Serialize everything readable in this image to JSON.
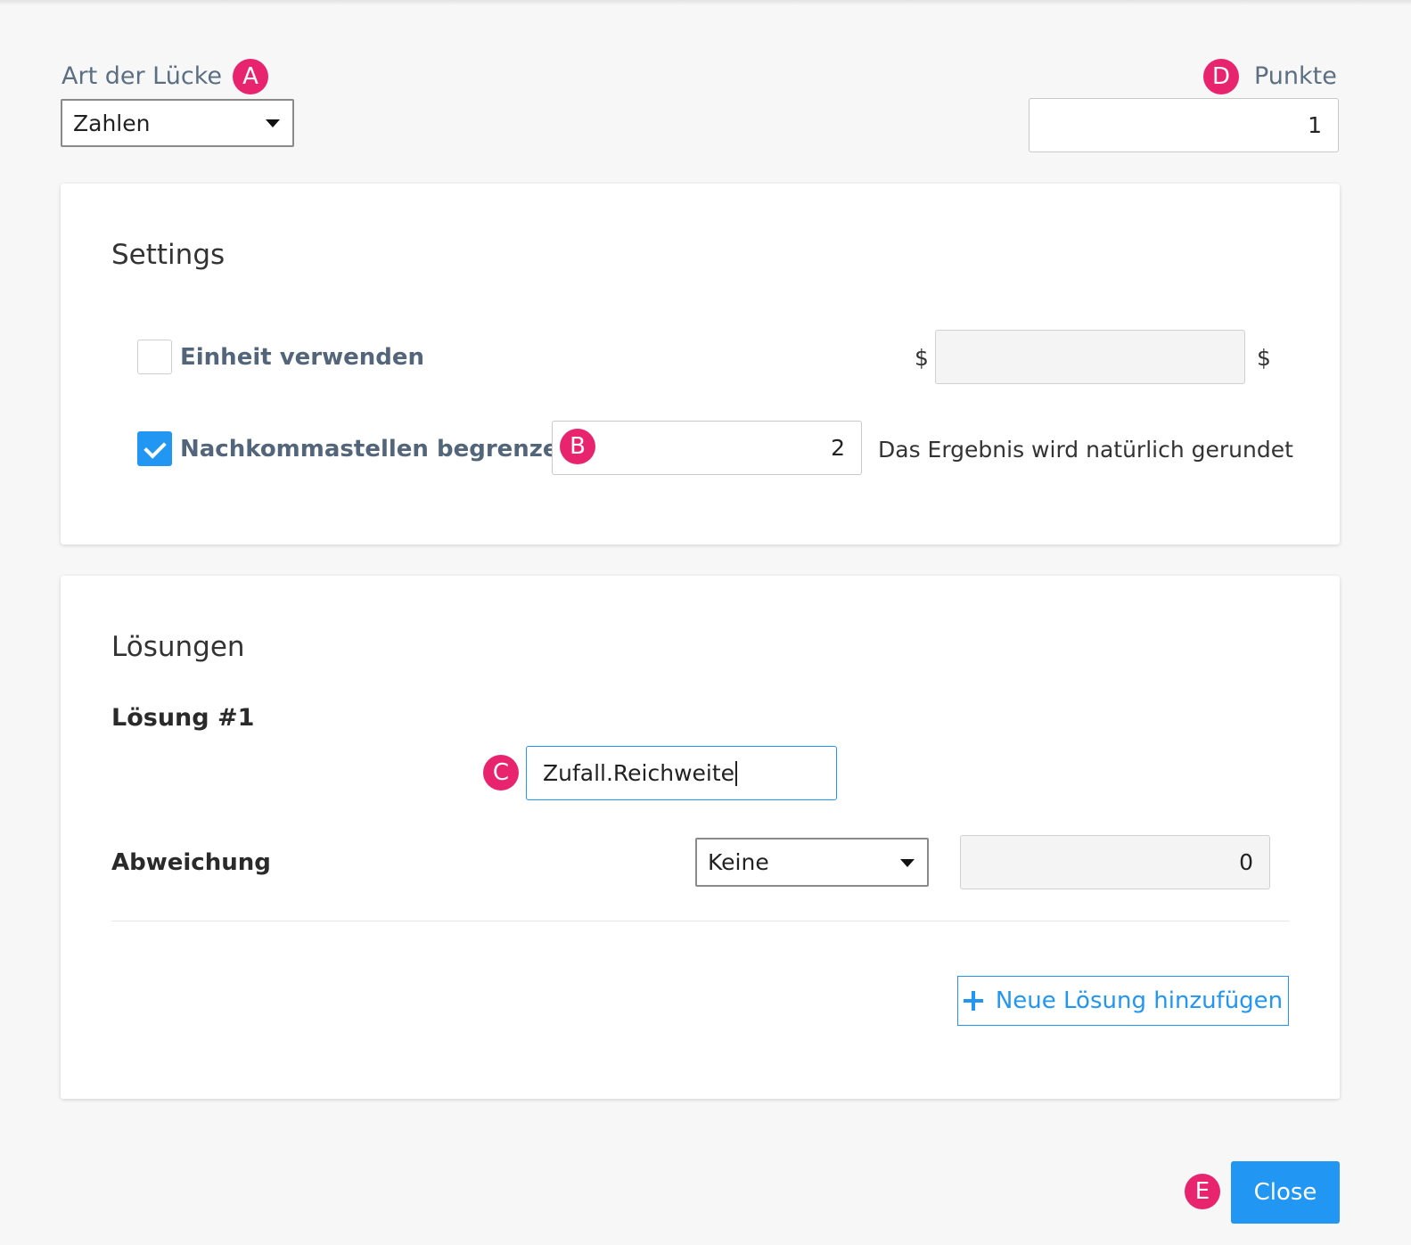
{
  "header": {
    "gap_type_label": "Art der Lücke",
    "gap_type_value": "Zahlen",
    "points_label": "Punkte",
    "points_value": "1"
  },
  "badges": {
    "a": "A",
    "b": "B",
    "c": "C",
    "d": "D",
    "e": "E"
  },
  "settings": {
    "title": "Settings",
    "use_unit": {
      "label": "Einheit verwenden",
      "checked": false,
      "prefix": "$",
      "suffix": "$",
      "value": ""
    },
    "limit_decimals": {
      "label": "Nachkommastellen begrenzen",
      "checked": true,
      "value": "2",
      "note": "Das Ergebnis wird natürlich gerundet"
    }
  },
  "solutions": {
    "title": "Lösungen",
    "items": [
      {
        "heading": "Lösung #1",
        "value": "Zufall.Reichweite",
        "deviation_label": "Abweichung",
        "deviation_type": "Keine",
        "deviation_value": "0"
      }
    ],
    "add_button": "Neue Lösung hinzufügen"
  },
  "footer": {
    "close_button": "Close"
  },
  "colors": {
    "accent": "#2196f3",
    "badge": "#e8246f",
    "label": "#5c6f82"
  }
}
